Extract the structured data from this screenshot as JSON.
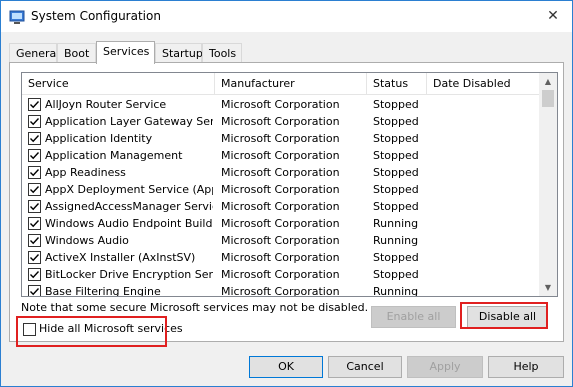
{
  "window": {
    "title": "System Configuration",
    "close_glyph": "✕"
  },
  "tabs": [
    {
      "label": "General",
      "active": false
    },
    {
      "label": "Boot",
      "active": false
    },
    {
      "label": "Services",
      "active": true
    },
    {
      "label": "Startup",
      "active": false
    },
    {
      "label": "Tools",
      "active": false
    }
  ],
  "list": {
    "columns": [
      "Service",
      "Manufacturer",
      "Status",
      "Date Disabled"
    ],
    "rows": [
      {
        "service": "AllJoyn Router Service",
        "manufacturer": "Microsoft Corporation",
        "status": "Stopped",
        "checked": true
      },
      {
        "service": "Application Layer Gateway Service",
        "manufacturer": "Microsoft Corporation",
        "status": "Stopped",
        "checked": true
      },
      {
        "service": "Application Identity",
        "manufacturer": "Microsoft Corporation",
        "status": "Stopped",
        "checked": true
      },
      {
        "service": "Application Management",
        "manufacturer": "Microsoft Corporation",
        "status": "Stopped",
        "checked": true
      },
      {
        "service": "App Readiness",
        "manufacturer": "Microsoft Corporation",
        "status": "Stopped",
        "checked": true
      },
      {
        "service": "AppX Deployment Service (AppX...",
        "manufacturer": "Microsoft Corporation",
        "status": "Stopped",
        "checked": true
      },
      {
        "service": "AssignedAccessManager Service",
        "manufacturer": "Microsoft Corporation",
        "status": "Stopped",
        "checked": true
      },
      {
        "service": "Windows Audio Endpoint Builder",
        "manufacturer": "Microsoft Corporation",
        "status": "Running",
        "checked": true
      },
      {
        "service": "Windows Audio",
        "manufacturer": "Microsoft Corporation",
        "status": "Running",
        "checked": true
      },
      {
        "service": "ActiveX Installer (AxInstSV)",
        "manufacturer": "Microsoft Corporation",
        "status": "Stopped",
        "checked": true
      },
      {
        "service": "BitLocker Drive Encryption Service",
        "manufacturer": "Microsoft Corporation",
        "status": "Stopped",
        "checked": true
      },
      {
        "service": "Base Filtering Engine",
        "manufacturer": "Microsoft Corporation",
        "status": "Running",
        "checked": true
      }
    ]
  },
  "note": "Note that some secure Microsoft services may not be disabled.",
  "buttons": {
    "enable_all": "Enable all",
    "disable_all": "Disable all",
    "ok": "OK",
    "cancel": "Cancel",
    "apply": "Apply",
    "help": "Help"
  },
  "hide_ms": {
    "label": "Hide all Microsoft services",
    "checked": false
  },
  "colors": {
    "highlight": "#e02020",
    "accent": "#0078d7"
  }
}
